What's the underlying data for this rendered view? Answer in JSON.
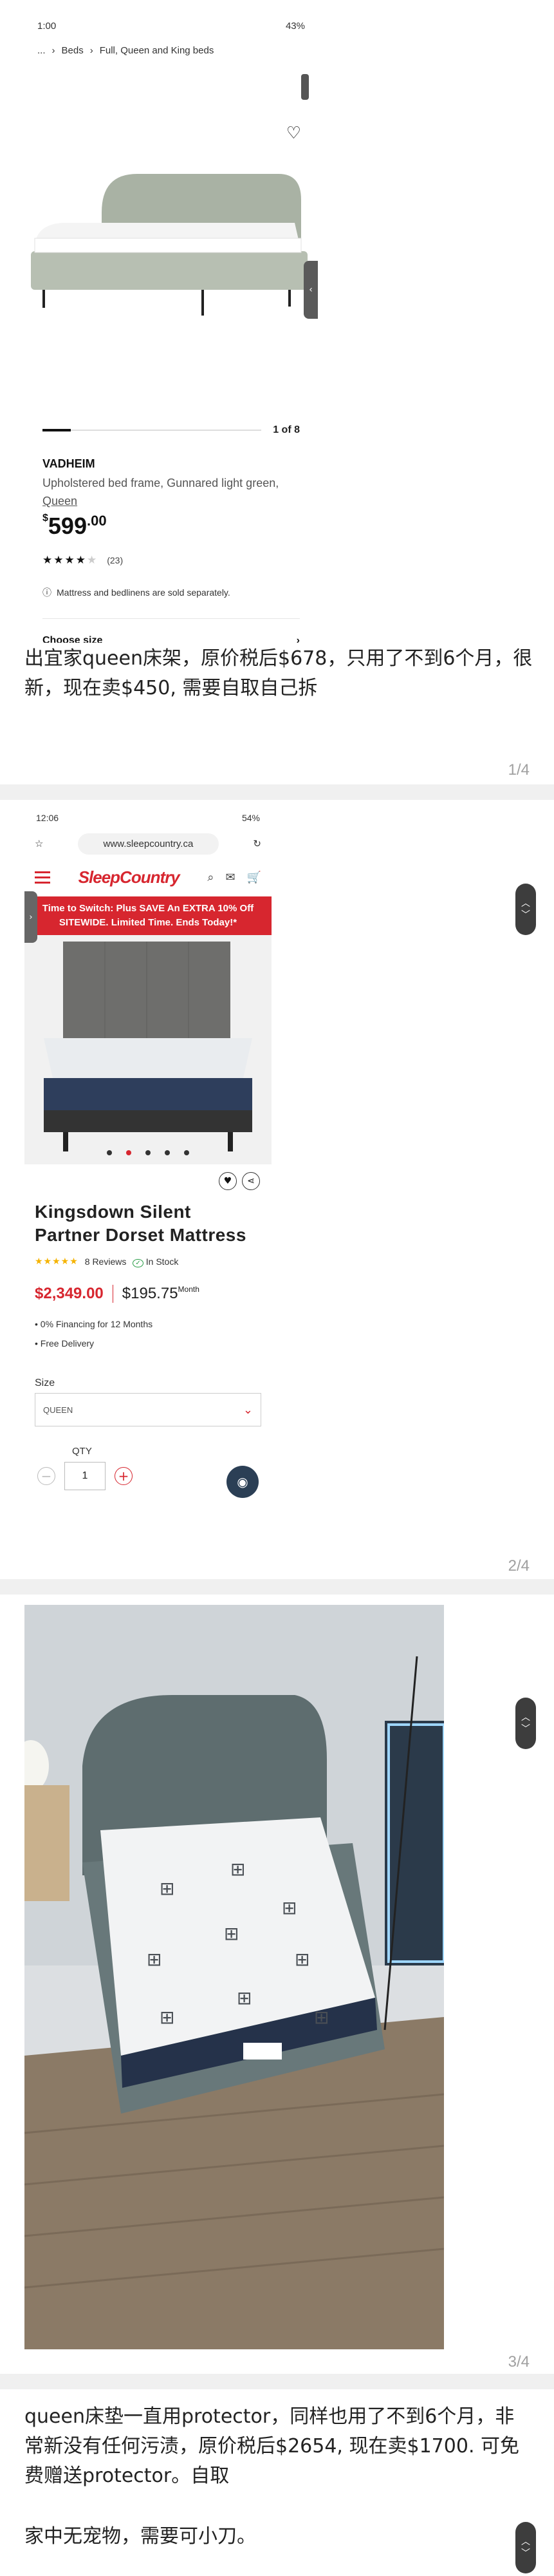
{
  "post1": {
    "status": {
      "time": "1:00",
      "battery": "43%"
    },
    "breadcrumb": {
      "ellipsis": "...",
      "level1": "Beds",
      "level2": "Full, Queen and King beds"
    },
    "gallery_counter": "1 of 8",
    "gallery_progress": 0.125,
    "product": {
      "brand": "VADHEIM",
      "desc_plain": "Upholstered bed frame, Gunnared light green, ",
      "desc_link": "Queen",
      "price_currency": "$",
      "price_main": "599",
      "price_cents": ".00",
      "rating_count": "(23)",
      "rating_stars": 4
    },
    "info_note": "Mattress and bedlinens are sold separately.",
    "choose_size": "Choose size",
    "caption": "出宜家queen床架，原价税后$678，只用了不到6个月，很新，现在卖$450, 需要自取自己拆",
    "pager": "1/4"
  },
  "post2": {
    "status": {
      "time": "12:06",
      "battery": "54%"
    },
    "url": "www.sleepcountry.ca",
    "logo": "SleepCountry",
    "banner": "Time to Switch: Plus SAVE An EXTRA 10% Off SITEWIDE. Limited Time. Ends Today!*",
    "carousel_active": 2,
    "carousel_total": 5,
    "title": "Kingsdown Silent Partner Dorset Mattress",
    "reviews": "8 Reviews",
    "review_stars": 5,
    "in_stock": "In Stock",
    "price": "$2,349.00",
    "monthly": "$195.75",
    "monthly_unit": "Month",
    "perks": [
      "• 0% Financing for 12 Months",
      "• Free Delivery"
    ],
    "size_label": "Size",
    "size_value": "QUEEN",
    "qty_label": "QTY",
    "qty_value": "1",
    "pager": "2/4"
  },
  "post3": {
    "pager": "3/4"
  },
  "caption4": {
    "line1": "queen床垫一直用protector，同样也用了不到6个月，非常新没有任何污渍，原价税后$2654, 现在卖$1700. 可免费赠送protector。自取",
    "line2": "家中无宠物，需要可小刀。"
  },
  "colors": {
    "brand_red": "#d7262f",
    "separator": "#f0f0f0",
    "pager": "#a0a0a0"
  },
  "icons": [
    "heart-icon",
    "share-icon",
    "search-icon",
    "chat-icon",
    "cart-icon",
    "chevron-down-icon",
    "info-icon"
  ]
}
